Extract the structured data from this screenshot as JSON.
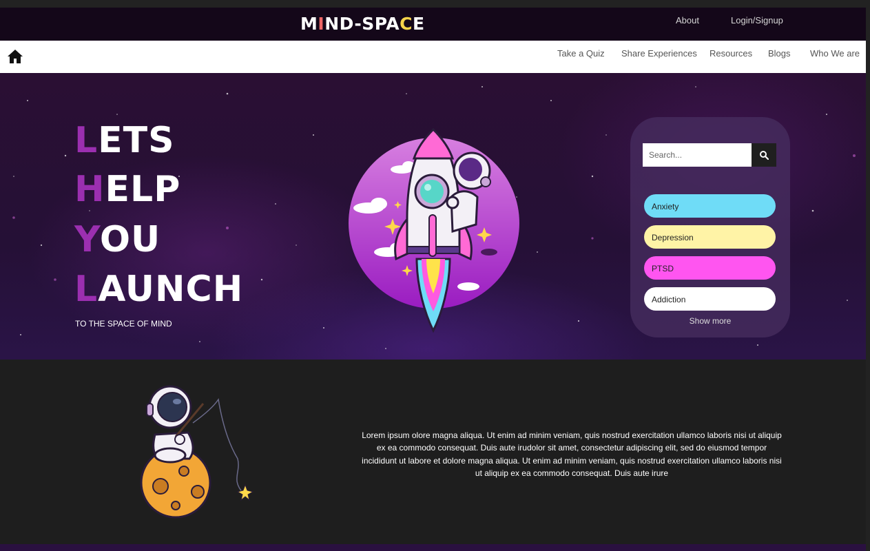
{
  "header": {
    "logo": {
      "before": "M",
      "rocket_glyph": "I",
      "middle": "ND-SPA",
      "moon_glyph": "C",
      "after": "E"
    },
    "links": [
      "About",
      "Login/Signup"
    ]
  },
  "nav": {
    "home_icon": "home-icon",
    "links": [
      "Take a Quiz",
      "Share Experiences",
      "Resources",
      "Blogs",
      "Who We are"
    ]
  },
  "hero": {
    "lines": [
      {
        "cap": "L",
        "rest": "ETS"
      },
      {
        "cap": "H",
        "rest": "ELP"
      },
      {
        "cap": "Y",
        "rest": "OU"
      },
      {
        "cap": "L",
        "rest": "AUNCH"
      }
    ],
    "tagline": "TO THE SPACE OF MIND",
    "accent_color": "#9b2fb0"
  },
  "search": {
    "placeholder": "Search...",
    "button_icon": "search-icon",
    "topics": [
      {
        "label": "Anxiety",
        "color": "#6fdcf7"
      },
      {
        "label": "Depression",
        "color": "#fff3a6"
      },
      {
        "label": "PTSD",
        "color": "#ff55f0"
      },
      {
        "label": "Addiction",
        "color": "#ffffff"
      }
    ],
    "show_more": "Show more"
  },
  "about": {
    "text": "Lorem ipsum olore magna aliqua. Ut enim ad minim veniam, quis nostrud exercitation ullamco laboris nisi ut aliquip ex ea commodo consequat. Duis aute irudolor sit amet, consectetur adipiscing elit, sed do eiusmod tempor incididunt ut labore et dolore magna aliqua. Ut enim ad minim veniam, quis nostrud exercitation ullamco laboris nisi ut aliquip ex ea commodo consequat. Duis aute irure"
  }
}
